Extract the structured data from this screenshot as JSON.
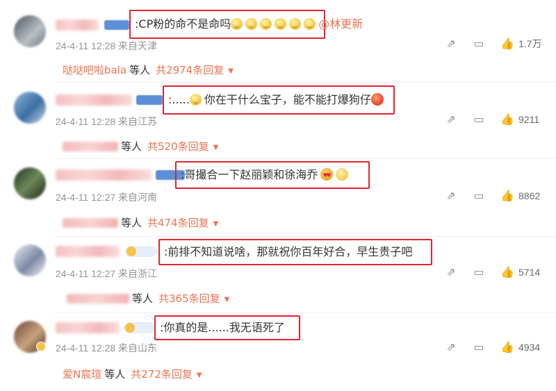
{
  "comments": [
    {
      "text": ":CP粉的命不是命吗",
      "mention": "@林更新",
      "time": "24-4-11 12:28",
      "location": "来自天津",
      "likes": "1.7万",
      "reply_user": "哒哒吧啦bala",
      "reply_etc": "等人",
      "reply_total": "共2974条回复"
    },
    {
      "text_prefix": ":.....",
      "text": "你在干什么宝子，能不能打爆狗仔",
      "time": "24-4-11 12:28",
      "location": "来自江苏",
      "likes": "9211",
      "reply_etc": "等人",
      "reply_total": "共520条回复"
    },
    {
      "text": ":哥撮合一下赵丽颖和徐海乔",
      "time": "24-4-11 12:27",
      "location": "来自河南",
      "likes": "8862",
      "reply_etc": "等人",
      "reply_total": "共474条回复"
    },
    {
      "text": ":前排不知道说啥，那就祝你百年好合，早生贵子吧",
      "time": "24-4-11 12:27",
      "location": "来自浙江",
      "likes": "5714",
      "reply_etc": "等人",
      "reply_total": "共365条回复"
    },
    {
      "text": ":你真的是......我无语死了",
      "time": "24-4-11 12:28",
      "location": "来自山东",
      "likes": "4934",
      "reply_user": "爱N宸瑄",
      "reply_etc": "等人",
      "reply_total": "共272条回复"
    }
  ],
  "icons": {
    "share": "share-icon",
    "comment": "comment-icon",
    "like": "thumbs-up-icon",
    "caret": "caret-down-icon"
  },
  "colors": {
    "accent": "#eb7350",
    "highlight_border": "#e0252f",
    "meta_gray": "#939393"
  }
}
